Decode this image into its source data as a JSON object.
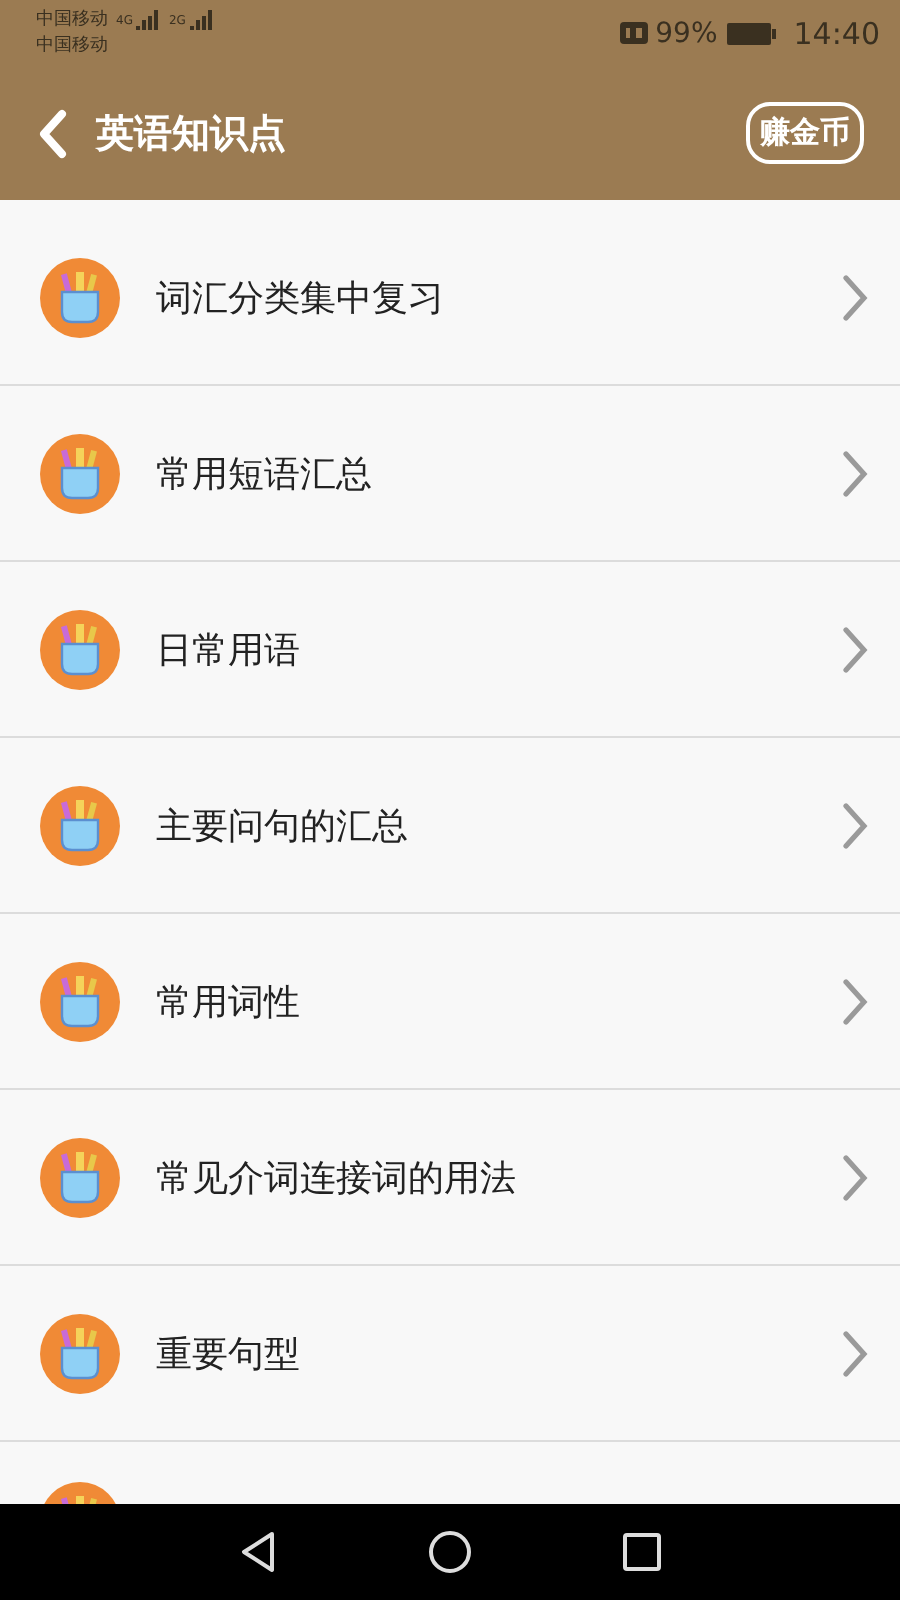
{
  "status_bar": {
    "carrier_1": "中国移动",
    "carrier_2": "中国移动",
    "network_1": "4G",
    "network_2": "2G",
    "battery": "99%",
    "time": "14:40"
  },
  "header": {
    "title": "英语知识点",
    "action": "赚金币"
  },
  "items": [
    {
      "label": "词汇分类集中复习"
    },
    {
      "label": "常用短语汇总"
    },
    {
      "label": "日常用语"
    },
    {
      "label": "主要问句的汇总"
    },
    {
      "label": "常用词性"
    },
    {
      "label": "常见介词连接词的用法"
    },
    {
      "label": "重要句型"
    }
  ]
}
